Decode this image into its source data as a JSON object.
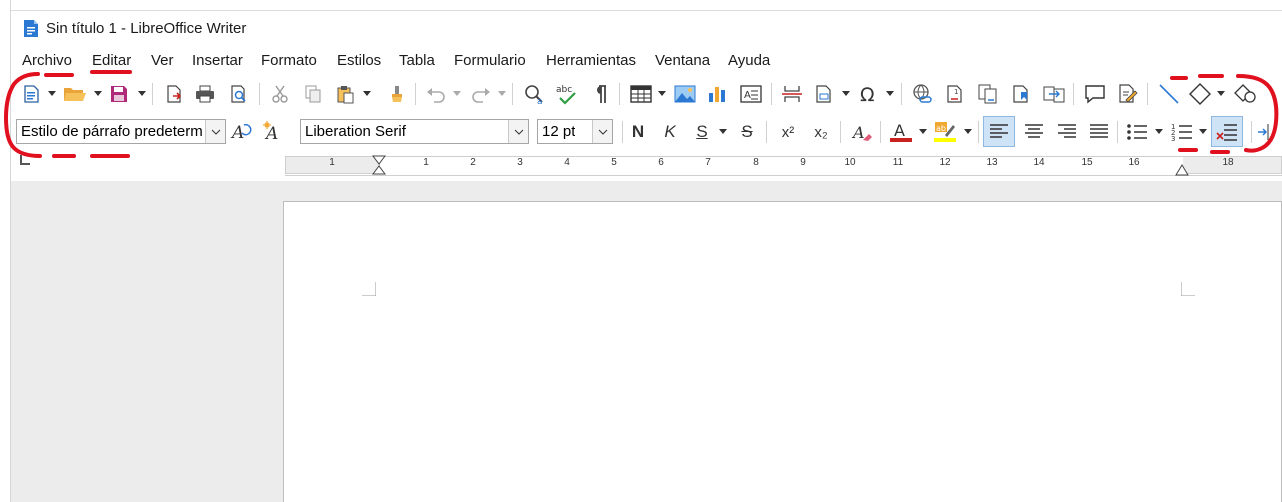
{
  "window": {
    "title": "Sin título 1 - LibreOffice Writer",
    "app_icon": "writer-doc-icon"
  },
  "menu": {
    "items": [
      "Archivo",
      "Editar",
      "Ver",
      "Insertar",
      "Formato",
      "Estilos",
      "Tabla",
      "Formulario",
      "Herramientas",
      "Ventana",
      "Ayuda"
    ]
  },
  "toolbar_standard": {
    "icons": [
      "new-document-icon",
      "open-folder-icon",
      "save-icon",
      "export-pdf-icon",
      "print-icon",
      "print-preview-icon",
      "cut-icon",
      "copy-icon",
      "paste-icon",
      "clone-formatting-icon",
      "undo-icon",
      "redo-icon",
      "find-replace-icon",
      "spelling-icon",
      "formatting-marks-icon",
      "insert-table-icon",
      "insert-image-icon",
      "insert-chart-icon",
      "insert-text-box-icon",
      "page-break-icon",
      "insert-field-icon",
      "special-character-icon",
      "hyperlink-icon",
      "footnote-icon",
      "endnote-icon",
      "bookmark-icon",
      "cross-reference-icon",
      "comment-icon",
      "track-changes-icon",
      "line-icon",
      "basic-shapes-icon",
      "draw-functions-icon"
    ]
  },
  "toolbar_formatting": {
    "paragraph_style": "Estilo de párrafo predeterm",
    "font_name": "Liberation Serif",
    "font_size": "12 pt",
    "bold_label": "N",
    "italic_label": "K",
    "underline_label": "S",
    "strike_label": "S",
    "superscript_label": "x²",
    "subscript_label": "x₂",
    "font_color": "#c9211e",
    "highlight_color": "#ffff00",
    "active_alignment": "align-left"
  },
  "ruler": {
    "numbers": [
      "1",
      "1",
      "2",
      "3",
      "4",
      "5",
      "6",
      "7",
      "8",
      "9",
      "10",
      "11",
      "12",
      "13",
      "14",
      "15",
      "16",
      "18"
    ]
  },
  "annotation_color": "#e0101e"
}
